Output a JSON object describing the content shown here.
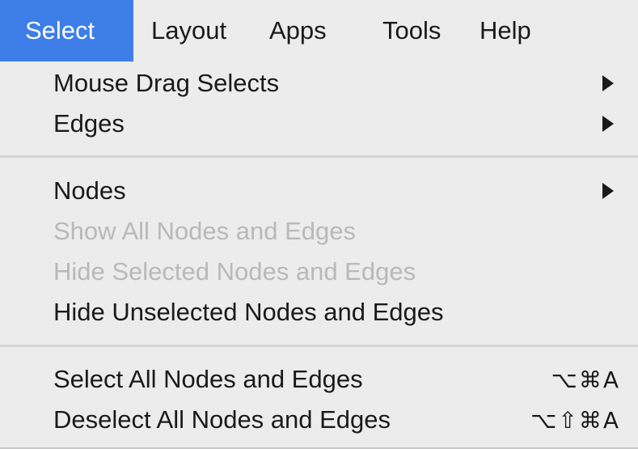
{
  "menubar": {
    "items": [
      {
        "label": "Select"
      },
      {
        "label": "Layout"
      },
      {
        "label": "Apps"
      },
      {
        "label": "Tools"
      },
      {
        "label": "Help"
      }
    ]
  },
  "menu": {
    "items": [
      {
        "label": "Mouse Drag Selects",
        "submenu": true,
        "enabled": true
      },
      {
        "label": "Edges",
        "submenu": true,
        "enabled": true
      },
      {
        "label": "Nodes",
        "submenu": true,
        "enabled": true
      },
      {
        "label": "Show All Nodes and Edges",
        "submenu": false,
        "enabled": false
      },
      {
        "label": "Hide Selected Nodes and Edges",
        "submenu": false,
        "enabled": false
      },
      {
        "label": "Hide Unselected Nodes and Edges",
        "submenu": false,
        "enabled": true
      },
      {
        "label": "Select All Nodes and Edges",
        "shortcut": "⌥⌘A",
        "enabled": true
      },
      {
        "label": "Deselect All Nodes and Edges",
        "shortcut": "⌥⇧⌘A",
        "enabled": true
      }
    ]
  },
  "colors": {
    "active_menu": "#3d7ee8",
    "menu_background": "#ececec",
    "disabled_text": "#b9b9b9"
  }
}
